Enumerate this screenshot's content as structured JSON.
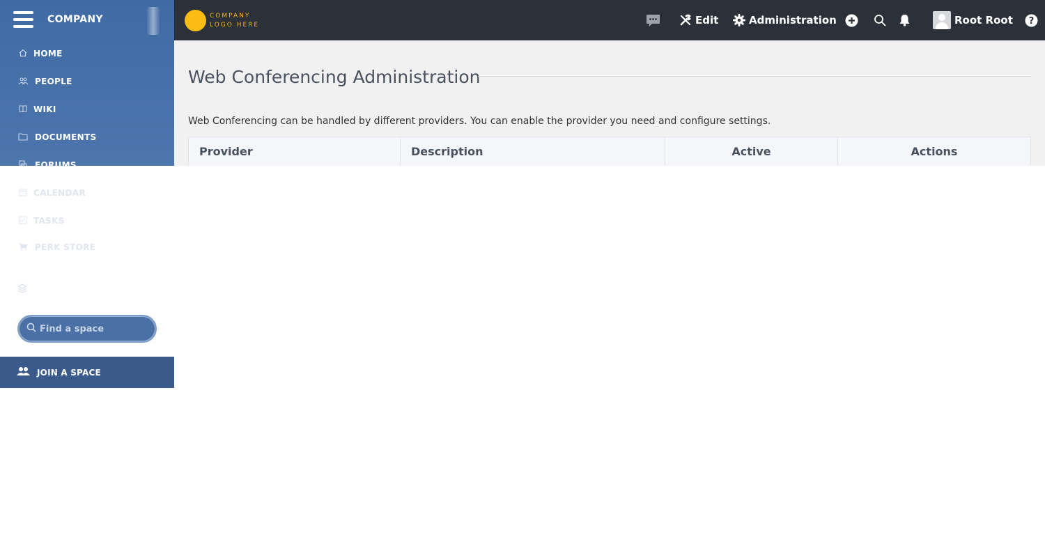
{
  "sidebar": {
    "brand": "COMPANY",
    "items": [
      {
        "label": "HOME",
        "icon": "home-icon"
      },
      {
        "label": "PEOPLE",
        "icon": "people-icon"
      },
      {
        "label": "WIKI",
        "icon": "book-icon"
      },
      {
        "label": "DOCUMENTS",
        "icon": "folder-icon"
      },
      {
        "label": "FORUMS",
        "icon": "forums-icon"
      },
      {
        "label": "CALENDAR",
        "icon": "calendar-icon"
      },
      {
        "label": "TASKS",
        "icon": "tasks-icon"
      },
      {
        "label": "PERK STORE",
        "icon": "cart-icon"
      }
    ],
    "find_space_placeholder": "Find a space",
    "join_space_label": "JOIN A SPACE"
  },
  "topbar": {
    "logo_line1": "COMPANY",
    "logo_line2": "LOGO HERE",
    "edit_label": "Edit",
    "admin_label": "Administration",
    "user_name": "Root Root"
  },
  "main": {
    "title": "Web Conferencing Administration",
    "intro": "Web Conferencing can be handled by different providers. You can enable the provider you need and configure settings.",
    "columns": [
      "Provider",
      "Description",
      "Active",
      "Actions"
    ]
  },
  "colors": {
    "sidebar_blue": "#476fa8",
    "topbar_dark": "#2c3038",
    "logo_yellow": "#fbbc14",
    "join_space_bg": "#3a5a8c"
  }
}
